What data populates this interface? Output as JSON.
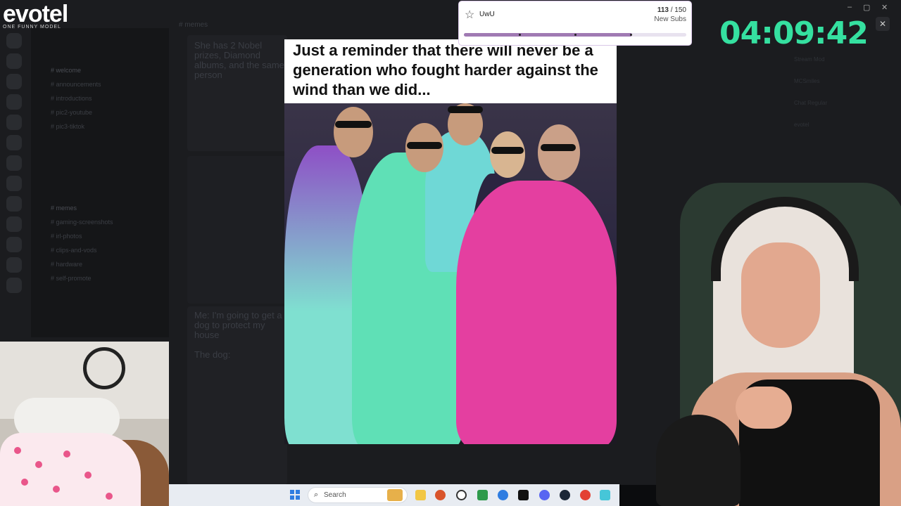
{
  "logo": {
    "name": "evotel",
    "sub": "ONE FUNNY MODEL"
  },
  "discord": {
    "channel_title": "# memes",
    "channels": [
      "# welcome",
      "# announcements",
      "# introductions",
      "# pic2-youtube",
      "# pic3-tiktok",
      "# memes",
      "# gaming-screenshots",
      "# irl-photos",
      "# clips-and-vods",
      "# hardware",
      "# self-promote"
    ],
    "members": [
      "Stream Mod",
      "MCSmiles",
      "Chat Regular",
      "evotel"
    ],
    "post1": "She has 2 Nobel prizes, Diamond albums, and the same person",
    "post2": "Me: I'm going to get a dog to protect my house\n\nThe dog:"
  },
  "meme": {
    "caption": "Just a reminder that there will never be a generation who fought harder against the wind than we did..."
  },
  "sub_goal": {
    "name": "UwU",
    "current": "113",
    "target": "/ 150",
    "label": "New Subs",
    "progress": 0.753
  },
  "timer": "04:09:42",
  "taskbar": {
    "search_placeholder": "Search"
  },
  "colors": {
    "timer": "#35e0a0",
    "goal_fill": "#a07ab3",
    "accent": "#2f7de1"
  }
}
